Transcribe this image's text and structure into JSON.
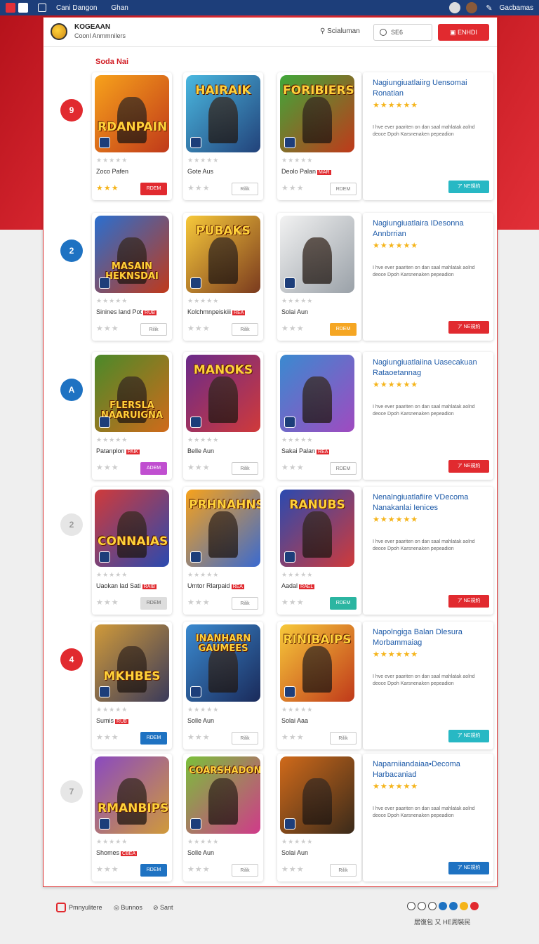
{
  "topbar": {
    "nav1": "Cani Dangon",
    "nav2": "Ghan",
    "user": "Gacbamas"
  },
  "header": {
    "brand": "KOGEAAN",
    "brand_sub": "Coonl Anmmnilers",
    "search_label": "Scialuman",
    "field_text": "SE6",
    "button": "ENHDI"
  },
  "section_title": "Soda Nai",
  "rows": [
    {
      "rank": "9",
      "rank_color": "#e12a2f",
      "cards": [
        {
          "title": "RDANPAIN",
          "colors": [
            "#f7a21b",
            "#c0391a"
          ],
          "name": "Zoco Pafen",
          "tag": "",
          "btn": "RDEM",
          "btn_style": "filled red"
        },
        {
          "title": "HAIRAIK",
          "colors": [
            "#4ab8e0",
            "#22427a"
          ],
          "name": "Gote Aus",
          "tag": "",
          "btn": "Rilik",
          "btn_style": "outline"
        },
        {
          "title": "FORIBIERS",
          "colors": [
            "#3fa83a",
            "#c0391a"
          ],
          "name": "Deolo Palan",
          "tag": "MAR",
          "btn": "RDEM",
          "btn_style": "outline",
          "wide": true
        }
      ],
      "info": {
        "title": "Nagiungiuatlaiirg Uensomai Ronatian",
        "desc": "I hve ever paariten on dan saal mahlatak aolnd deoce Dpoh Karsnenaken pepeadion",
        "btn": "ア NE規約",
        "btn_color": "#27b8c4"
      }
    },
    {
      "rank": "2",
      "rank_color": "#1e72c2",
      "cards": [
        {
          "title": "MASAIN HEKNSDAI",
          "colors": [
            "#2a6fd0",
            "#c0391a"
          ],
          "name": "Sinines land Pot",
          "tag": "RUB",
          "btn": "Rilik",
          "btn_style": "outline"
        },
        {
          "title": "PUBAKS",
          "colors": [
            "#f7c93a",
            "#7a3a1e"
          ],
          "name": "Kolchmnpeiskiii",
          "tag": "REA",
          "btn": "Rilik",
          "btn_style": "outline"
        },
        {
          "title": "",
          "colors": [
            "#f2f2f2",
            "#9aa1a8"
          ],
          "name": "Solai Aun",
          "tag": "",
          "btn": "RDEM",
          "btn_style": "filled orange",
          "wide": true
        }
      ],
      "info": {
        "title": "Nagiungiuatlaira IDesonna Annbrrian",
        "desc": "I hve ever paariten on dan saal mahlatak aolnd deoce Dpoh Karsnenaken pepeadion",
        "btn": "ア NE規約",
        "btn_color": "#e12a2f"
      }
    },
    {
      "rank": "A",
      "rank_color": "#1e72c2",
      "cards": [
        {
          "title": "FLERSLA NAARUIGNA",
          "colors": [
            "#4a8a2a",
            "#d06a1a"
          ],
          "name": "Patanplon",
          "tag": "PAIK",
          "btn": "ADEM",
          "btn_style": "filled purple"
        },
        {
          "title": "MANOKS",
          "colors": [
            "#6a2a8a",
            "#d03a3a"
          ],
          "name": "Belle Aun",
          "tag": "",
          "btn": "Rilik",
          "btn_style": "outline"
        },
        {
          "title": "",
          "colors": [
            "#3a8ad0",
            "#a04ac0"
          ],
          "name": "Sakai Palan",
          "tag": "REA",
          "btn": "RDEM",
          "btn_style": "outline",
          "wide": true
        }
      ],
      "info": {
        "title": "Nagiungiuatlaiina Uasecakuan Rataoetannag",
        "desc": "I hve ever paariten on dan saal mahlatak aolnd deoce Dpoh Karsnenaken pepeadion",
        "btn": "ア NE規約",
        "btn_color": "#e12a2f"
      }
    },
    {
      "rank": "2",
      "rank_color": "#e6e6e6",
      "cards": [
        {
          "title": "CONNAIAS",
          "colors": [
            "#d03a3a",
            "#2a4ab0"
          ],
          "name": "Uaokan lad Sati",
          "tag": "RAIB",
          "btn": "RDEM",
          "btn_style": "filled gray"
        },
        {
          "title": "PRHNAHNS",
          "colors": [
            "#f7a21b",
            "#3a6ad0"
          ],
          "name": "Umtor Rlarpaid",
          "tag": "REA",
          "btn": "Rilik",
          "btn_style": "outline"
        },
        {
          "title": "RANUBS",
          "colors": [
            "#2a4ab0",
            "#d03a3a"
          ],
          "name": "Aadal",
          "tag": "RAEL",
          "btn": "RDEM",
          "btn_style": "filled green",
          "wide": true
        }
      ],
      "info": {
        "title": "Nenalngiuatlafiire VDecoma Nanakanlai Ienices",
        "desc": "I hve ever paariten on dan saal mahlatak aolnd deoce Dpoh Karsnenaken pepeadion",
        "btn": "ア NE規約",
        "btn_color": "#e12a2f"
      }
    },
    {
      "rank": "4",
      "rank_color": "#e12a2f",
      "cards": [
        {
          "title": "MKHBES",
          "colors": [
            "#d09a3a",
            "#3a3a5a"
          ],
          "name": "Sumis",
          "tag": "RUB",
          "btn": "RDEM",
          "btn_style": "filled blue"
        },
        {
          "title": "INANHARN GAUMEES",
          "colors": [
            "#3a8ad0",
            "#1a2a5a"
          ],
          "name": "Solle Aun",
          "tag": "",
          "btn": "Rilik",
          "btn_style": "outline"
        },
        {
          "title": "RINIBAIPS",
          "colors": [
            "#f7c93a",
            "#c0391a"
          ],
          "name": "Solai Aaa",
          "tag": "",
          "btn": "Rilik",
          "btn_style": "outline",
          "wide": true
        }
      ],
      "info": {
        "title": "Napolngiga Balan Dlesura Morbammaiag",
        "desc": "I hve ever paariten on dan saal mahlatak aolnd deoce Dpoh Karsnenaken pepeadion",
        "btn": "ア NE規約",
        "btn_color": "#27b8c4"
      }
    },
    {
      "rank": "7",
      "rank_color": "#e6e6e6",
      "cards": [
        {
          "title": "RMANBIPS",
          "colors": [
            "#8a4ac0",
            "#d09a3a"
          ],
          "name": "Shomes",
          "tag": "CBEA",
          "btn": "RDEM",
          "btn_style": "filled blue"
        },
        {
          "title": "COARSHADON",
          "colors": [
            "#7ac03a",
            "#d03a8a"
          ],
          "name": "Solle Aun",
          "tag": "",
          "btn": "Rilik",
          "btn_style": "outline"
        },
        {
          "title": "",
          "colors": [
            "#d06a1a",
            "#3a2a1a"
          ],
          "name": "Solai Aun",
          "tag": "",
          "btn": "Rilik",
          "btn_style": "outline",
          "wide": true
        }
      ],
      "info": {
        "title": "Naparniiandaiaa•Decoma Harbacaniad",
        "desc": "I hve ever paariten on dan saal mahlatak aolnd deoce Dpoh Karsnenaken pepeadion",
        "btn": "ア NE規約",
        "btn_color": "#1e72c2"
      }
    }
  ],
  "footer": {
    "link1": "Pmnyulitere",
    "link2": "Bunnos",
    "link3": "Sant",
    "copy": "居復包 又 HE周裝民"
  }
}
